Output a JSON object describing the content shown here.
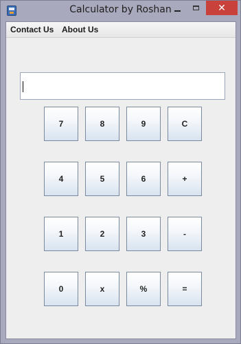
{
  "window": {
    "title": "Calculator by Roshan",
    "close_glyph": "✕"
  },
  "menu": {
    "items": [
      {
        "label": "Contact Us"
      },
      {
        "label": "About Us"
      }
    ]
  },
  "display": {
    "value": ""
  },
  "keypad": {
    "rows": [
      [
        "7",
        "8",
        "9",
        "C"
      ],
      [
        "4",
        "5",
        "6",
        "+"
      ],
      [
        "1",
        "2",
        "3",
        "-"
      ],
      [
        "0",
        "x",
        "%",
        "="
      ]
    ]
  },
  "colors": {
    "title_bar": "#a9a9be",
    "close_button": "#c8413a",
    "client_bg": "#eeeeee"
  }
}
